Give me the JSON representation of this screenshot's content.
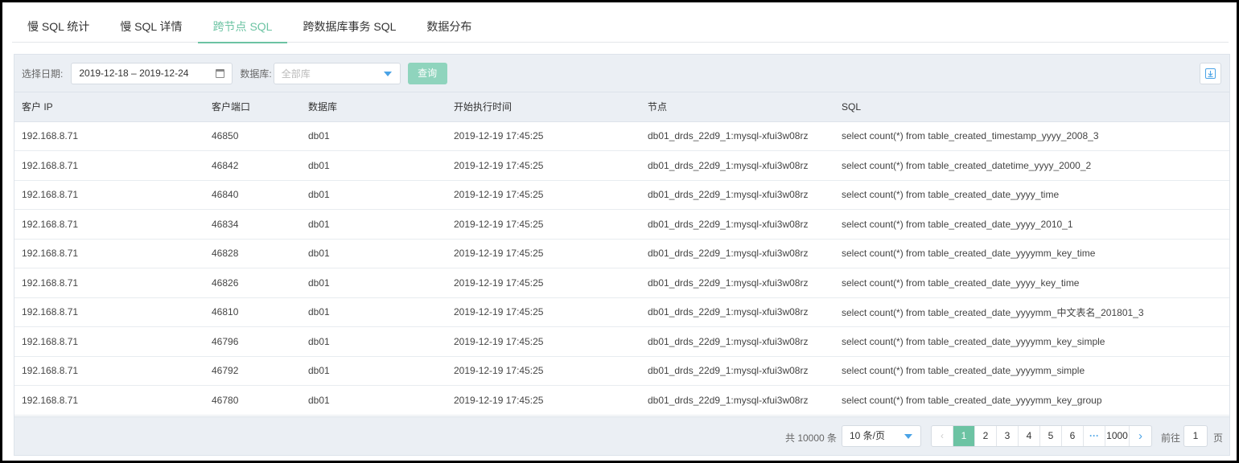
{
  "tabs": [
    {
      "label": "慢 SQL 统计",
      "active": false
    },
    {
      "label": "慢 SQL 详情",
      "active": false
    },
    {
      "label": "跨节点 SQL",
      "active": true
    },
    {
      "label": "跨数据库事务 SQL",
      "active": false
    },
    {
      "label": "数据分布",
      "active": false
    }
  ],
  "toolbar": {
    "date_label": "选择日期:",
    "date_range": "2019-12-18 – 2019-12-24",
    "db_label": "数据库:",
    "db_placeholder": "全部库",
    "query_label": "查询"
  },
  "table": {
    "headers": [
      "客户 IP",
      "客户端口",
      "数据库",
      "开始执行时间",
      "节点",
      "SQL"
    ],
    "rows": [
      [
        "192.168.8.71",
        "46850",
        "db01",
        "2019-12-19 17:45:25",
        "db01_drds_22d9_1:mysql-xfui3w08rz",
        "select count(*) from table_created_timestamp_yyyy_2008_3"
      ],
      [
        "192.168.8.71",
        "46842",
        "db01",
        "2019-12-19 17:45:25",
        "db01_drds_22d9_1:mysql-xfui3w08rz",
        "select count(*) from table_created_datetime_yyyy_2000_2"
      ],
      [
        "192.168.8.71",
        "46840",
        "db01",
        "2019-12-19 17:45:25",
        "db01_drds_22d9_1:mysql-xfui3w08rz",
        "select count(*) from table_created_date_yyyy_time"
      ],
      [
        "192.168.8.71",
        "46834",
        "db01",
        "2019-12-19 17:45:25",
        "db01_drds_22d9_1:mysql-xfui3w08rz",
        "select count(*) from table_created_date_yyyy_2010_1"
      ],
      [
        "192.168.8.71",
        "46828",
        "db01",
        "2019-12-19 17:45:25",
        "db01_drds_22d9_1:mysql-xfui3w08rz",
        "select count(*) from table_created_date_yyyymm_key_time"
      ],
      [
        "192.168.8.71",
        "46826",
        "db01",
        "2019-12-19 17:45:25",
        "db01_drds_22d9_1:mysql-xfui3w08rz",
        "select count(*) from table_created_date_yyyy_key_time"
      ],
      [
        "192.168.8.71",
        "46810",
        "db01",
        "2019-12-19 17:45:25",
        "db01_drds_22d9_1:mysql-xfui3w08rz",
        "select count(*) from table_created_date_yyyymm_中文表名_201801_3"
      ],
      [
        "192.168.8.71",
        "46796",
        "db01",
        "2019-12-19 17:45:25",
        "db01_drds_22d9_1:mysql-xfui3w08rz",
        "select count(*) from table_created_date_yyyymm_key_simple"
      ],
      [
        "192.168.8.71",
        "46792",
        "db01",
        "2019-12-19 17:45:25",
        "db01_drds_22d9_1:mysql-xfui3w08rz",
        "select count(*) from table_created_date_yyyymm_simple"
      ],
      [
        "192.168.8.71",
        "46780",
        "db01",
        "2019-12-19 17:45:25",
        "db01_drds_22d9_1:mysql-xfui3w08rz",
        "select count(*) from table_created_date_yyyymm_key_group"
      ]
    ]
  },
  "pagination": {
    "total": "共 10000 条",
    "page_size": "10 条/页",
    "pages": [
      "1",
      "2",
      "3",
      "4",
      "5",
      "6"
    ],
    "ellipsis": "···",
    "last_page": "1000",
    "prev": "‹",
    "next": "›",
    "goto_label": "前往",
    "goto_value": "1",
    "page_unit": "页"
  },
  "colors": {
    "accent": "#6cc3a3",
    "link": "#4aa3e6",
    "header_bg": "#ebeff4"
  },
  "icons": [
    "calendar-icon",
    "chevron-down-icon",
    "download-icon",
    "chevron-left-icon",
    "chevron-right-icon"
  ]
}
